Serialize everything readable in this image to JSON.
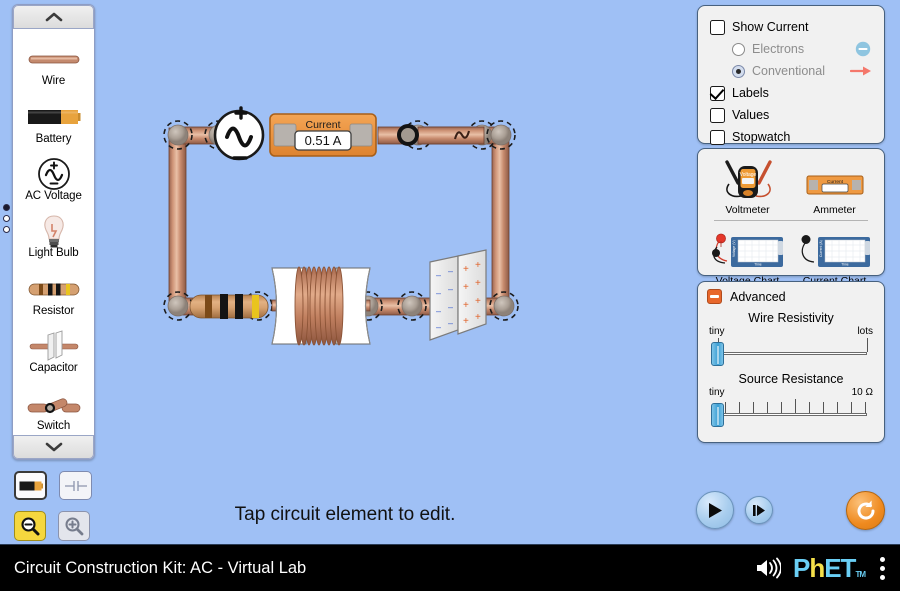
{
  "sim": {
    "title": "Circuit Construction Kit: AC - Virtual Lab",
    "hint": "Tap circuit element to edit.",
    "background_color": "#9fc0f5",
    "logo_text_p": "P",
    "logo_text_h": "h",
    "logo_text_et": "ET",
    "logo_tm": "TM"
  },
  "carousel": {
    "up_arrow": "chevron-up-icon",
    "down_arrow": "chevron-down-icon",
    "items": [
      {
        "label": "Wire",
        "icon": "wire-icon"
      },
      {
        "label": "Battery",
        "icon": "battery-icon"
      },
      {
        "label": "AC Voltage",
        "icon": "ac-voltage-icon"
      },
      {
        "label": "Light Bulb",
        "icon": "light-bulb-icon"
      },
      {
        "label": "Resistor",
        "icon": "resistor-icon"
      },
      {
        "label": "Capacitor",
        "icon": "capacitor-icon"
      },
      {
        "label": "Switch",
        "icon": "switch-icon"
      }
    ],
    "page_dots": [
      true,
      false,
      false
    ]
  },
  "view_controls": {
    "lifelike_icon": "battery-lifelike-icon",
    "lifelike_selected": true,
    "schematic_icon": "capacitor-schematic-icon",
    "schematic_selected": false,
    "zoom_out_icon": "magnifier-minus-icon",
    "zoom_out_active": true,
    "zoom_in_icon": "magnifier-plus-icon",
    "zoom_in_active": false
  },
  "display_panel": {
    "show_current": {
      "label": "Show Current",
      "checked": false
    },
    "electrons": {
      "label": "Electrons",
      "selected": false,
      "icon": "electron-minus-icon",
      "color": "#8fc5e0"
    },
    "conventional": {
      "label": "Conventional",
      "selected": true,
      "icon": "conventional-arrow-icon",
      "color": "#f4776b"
    },
    "labels": {
      "label": "Labels",
      "checked": true
    },
    "values": {
      "label": "Values",
      "checked": false
    },
    "stopwatch": {
      "label": "Stopwatch",
      "checked": false
    }
  },
  "tools_panel": {
    "voltmeter": {
      "label": "Voltmeter",
      "icon": "voltmeter-icon",
      "readout": "Voltage"
    },
    "ammeter": {
      "label": "Ammeter",
      "icon": "ammeter-icon",
      "readout": "Current"
    },
    "voltage_chart": {
      "label": "Voltage Chart",
      "icon": "voltage-chart-icon",
      "axis": "Voltage (V)",
      "xaxis": "Time"
    },
    "current_chart": {
      "label": "Current Chart",
      "icon": "current-chart-icon",
      "axis": "Current (A)",
      "xaxis": "Time"
    }
  },
  "advanced_panel": {
    "title": "Advanced",
    "expanded": true,
    "wire_resistivity": {
      "title": "Wire Resistivity",
      "min_label": "tiny",
      "max_label": "lots",
      "value_fraction": 0.0,
      "tick_count": 0
    },
    "source_resistance": {
      "title": "Source Resistance",
      "min_label": "tiny",
      "max_label": "10 Ω",
      "value_fraction": 0.0,
      "tick_count": 11
    }
  },
  "sim_controls": {
    "play": {
      "icon": "play-icon",
      "label": "Play"
    },
    "step": {
      "icon": "step-forward-icon",
      "label": "Step Forward"
    },
    "reset": {
      "icon": "reset-all-icon",
      "label": "Reset All"
    },
    "sound": {
      "icon": "sound-on-icon"
    },
    "menu": {
      "icon": "kebab-menu-icon"
    }
  },
  "circuit": {
    "ammeter": {
      "title": "Current",
      "value": "0.51 A"
    },
    "elements": [
      {
        "name": "ac-voltage-source",
        "type": "ac-source"
      },
      {
        "name": "ammeter-series",
        "type": "series-ammeter",
        "reading": "0.51 A"
      },
      {
        "name": "switch-closed",
        "type": "switch"
      },
      {
        "name": "resistor",
        "type": "resistor"
      },
      {
        "name": "inductor",
        "type": "inductor"
      },
      {
        "name": "capacitor",
        "type": "capacitor"
      }
    ],
    "wire_color": "#c08264",
    "highlight_color": "#1c1c1c"
  }
}
